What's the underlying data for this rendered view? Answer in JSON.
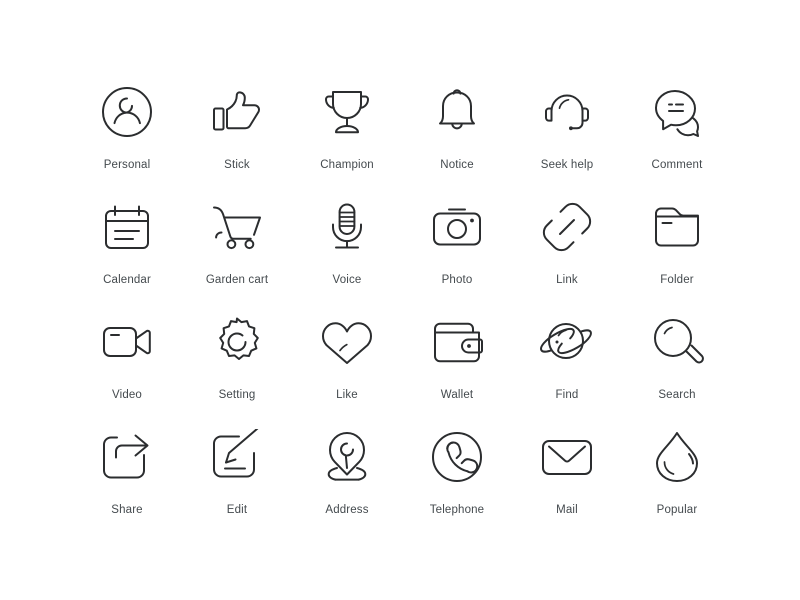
{
  "sheet": {
    "background_color": "#ffffff",
    "stroke_color": "#2b2d2f",
    "label_color": "#444a4e",
    "columns": 6,
    "rows": 4
  },
  "icons": [
    {
      "name": "personal",
      "label": "Personal",
      "glyph": "user-circle-icon"
    },
    {
      "name": "stick",
      "label": "Stick",
      "glyph": "thumbs-up-icon"
    },
    {
      "name": "champion",
      "label": "Champion",
      "glyph": "trophy-icon"
    },
    {
      "name": "notice",
      "label": "Notice",
      "glyph": "bell-icon"
    },
    {
      "name": "seek-help",
      "label": "Seek help",
      "glyph": "headset-icon"
    },
    {
      "name": "comment",
      "label": "Comment",
      "glyph": "speech-bubble-icon"
    },
    {
      "name": "calendar",
      "label": "Calendar",
      "glyph": "calendar-icon"
    },
    {
      "name": "garden-cart",
      "label": "Garden cart",
      "glyph": "shopping-cart-icon"
    },
    {
      "name": "voice",
      "label": "Voice",
      "glyph": "microphone-icon"
    },
    {
      "name": "photo",
      "label": "Photo",
      "glyph": "camera-icon"
    },
    {
      "name": "link",
      "label": "Link",
      "glyph": "chain-link-icon"
    },
    {
      "name": "folder",
      "label": "Folder",
      "glyph": "folder-icon"
    },
    {
      "name": "video",
      "label": "Video",
      "glyph": "video-camera-icon"
    },
    {
      "name": "setting",
      "label": "Setting",
      "glyph": "gear-icon"
    },
    {
      "name": "like",
      "label": "Like",
      "glyph": "heart-icon"
    },
    {
      "name": "wallet",
      "label": "Wallet",
      "glyph": "wallet-icon"
    },
    {
      "name": "find",
      "label": "Find",
      "glyph": "planet-icon"
    },
    {
      "name": "search",
      "label": "Search",
      "glyph": "magnifier-icon"
    },
    {
      "name": "share",
      "label": "Share",
      "glyph": "share-arrow-icon"
    },
    {
      "name": "edit",
      "label": "Edit",
      "glyph": "pencil-square-icon"
    },
    {
      "name": "address",
      "label": "Address",
      "glyph": "map-pin-icon"
    },
    {
      "name": "telephone",
      "label": "Telephone",
      "glyph": "phone-circle-icon"
    },
    {
      "name": "mail",
      "label": "Mail",
      "glyph": "envelope-icon"
    },
    {
      "name": "popular",
      "label": "Popular",
      "glyph": "flame-drop-icon"
    }
  ]
}
